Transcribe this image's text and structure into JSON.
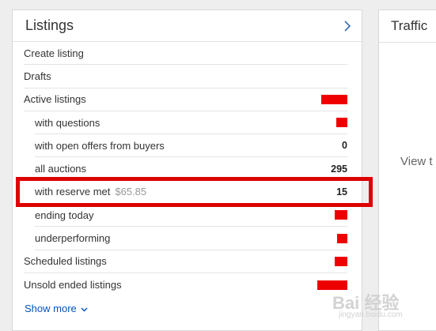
{
  "listings": {
    "title": "Listings",
    "rows": [
      {
        "label": "Create listing",
        "amount": "",
        "count": ""
      },
      {
        "label": "Drafts",
        "amount": "",
        "count": ""
      },
      {
        "label": "Active listings",
        "amount": "",
        "count": ""
      },
      {
        "label": "with questions",
        "amount": "",
        "count": ""
      },
      {
        "label": "with open offers from buyers",
        "amount": "",
        "count": "0"
      },
      {
        "label": "all auctions",
        "amount": "",
        "count": "295"
      },
      {
        "label": "with reserve met",
        "amount": "$65.85",
        "count": "15"
      },
      {
        "label": "ending today",
        "amount": "",
        "count": ""
      },
      {
        "label": "underperforming",
        "amount": "",
        "count": ""
      },
      {
        "label": "Scheduled listings",
        "amount": "",
        "count": ""
      },
      {
        "label": "Unsold ended listings",
        "amount": "",
        "count": ""
      }
    ],
    "show_more": "Show more"
  },
  "traffic": {
    "title": "Traffic",
    "body_text": "View t"
  },
  "watermark": {
    "brand": "Bai 经验",
    "url": "jingyan.baidu.com"
  },
  "colors": {
    "redaction": "#ee0000",
    "highlight_border": "#dd0000",
    "link": "#0654ba"
  }
}
